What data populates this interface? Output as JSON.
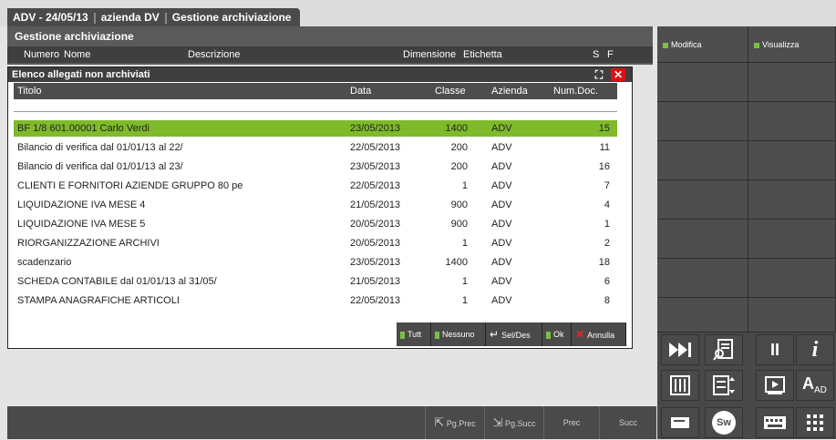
{
  "tab": {
    "part1": "ADV - 24/05/13",
    "part2": "azienda DV",
    "part3": "Gestione archiviazione"
  },
  "background_window": {
    "title": "Gestione archiviazione",
    "columns": [
      "Numero",
      "Nome",
      "Descrizione",
      "Dimensione",
      "Etichetta",
      "S",
      "F"
    ]
  },
  "dialog": {
    "title": "Elenco allegati non archiviati",
    "columns": {
      "titolo": "Titolo",
      "data": "Data",
      "classe": "Classe",
      "azienda": "Azienda",
      "numdoc": "Num.Doc."
    },
    "rows": [
      {
        "titolo": "BF 1/8 601.00001 Carlo Verdi",
        "data": "23/05/2013",
        "classe": "1400",
        "azienda": "ADV",
        "numdoc": "15",
        "selected": true
      },
      {
        "titolo": "Bilancio di verifica dal 01/01/13 al 22/",
        "data": "22/05/2013",
        "classe": "200",
        "azienda": "ADV",
        "numdoc": "11"
      },
      {
        "titolo": "Bilancio di verifica dal 01/01/13 al 23/",
        "data": "23/05/2013",
        "classe": "200",
        "azienda": "ADV",
        "numdoc": "16"
      },
      {
        "titolo": "CLIENTI E FORNITORI AZIENDE GRUPPO 80 pe",
        "data": "22/05/2013",
        "classe": "1",
        "azienda": "ADV",
        "numdoc": "7"
      },
      {
        "titolo": "LIQUIDAZIONE IVA MESE 4",
        "data": "21/05/2013",
        "classe": "900",
        "azienda": "ADV",
        "numdoc": "4"
      },
      {
        "titolo": "LIQUIDAZIONE IVA MESE 5",
        "data": "20/05/2013",
        "classe": "900",
        "azienda": "ADV",
        "numdoc": "1"
      },
      {
        "titolo": "RIORGANIZZAZIONE ARCHIVI",
        "data": "20/05/2013",
        "classe": "1",
        "azienda": "ADV",
        "numdoc": "2"
      },
      {
        "titolo": "scadenzario",
        "data": "23/05/2013",
        "classe": "1400",
        "azienda": "ADV",
        "numdoc": "18"
      },
      {
        "titolo": "SCHEDA CONTABILE  dal 01/01/13 al 31/05/",
        "data": "21/05/2013",
        "classe": "1",
        "azienda": "ADV",
        "numdoc": "6"
      },
      {
        "titolo": "STAMPA ANAGRAFICHE ARTICOLI",
        "data": "22/05/2013",
        "classe": "1",
        "azienda": "ADV",
        "numdoc": "8"
      }
    ],
    "buttons": {
      "tutti": "Tutt",
      "nessuno": "Nessuno",
      "sel_des": "Sel/Des",
      "ok": "Ok",
      "annulla": "Annulla"
    }
  },
  "right_panel": {
    "modifica": "Modifica",
    "visualizza": "Visualizza",
    "icon_i": "i",
    "icon_pause": "II",
    "icon_a": "A",
    "icon_a_sub": "AD",
    "icon_sw": "Sw"
  },
  "bottom_bar": {
    "pg_prec": "Pg.Prec",
    "pg_succ": "Pg.Succ",
    "prec": "Prec",
    "succ": "Succ"
  },
  "colors": {
    "selected_row": "#7fba2a",
    "accent_green": "#7bc043",
    "close_red": "#dd1111"
  }
}
